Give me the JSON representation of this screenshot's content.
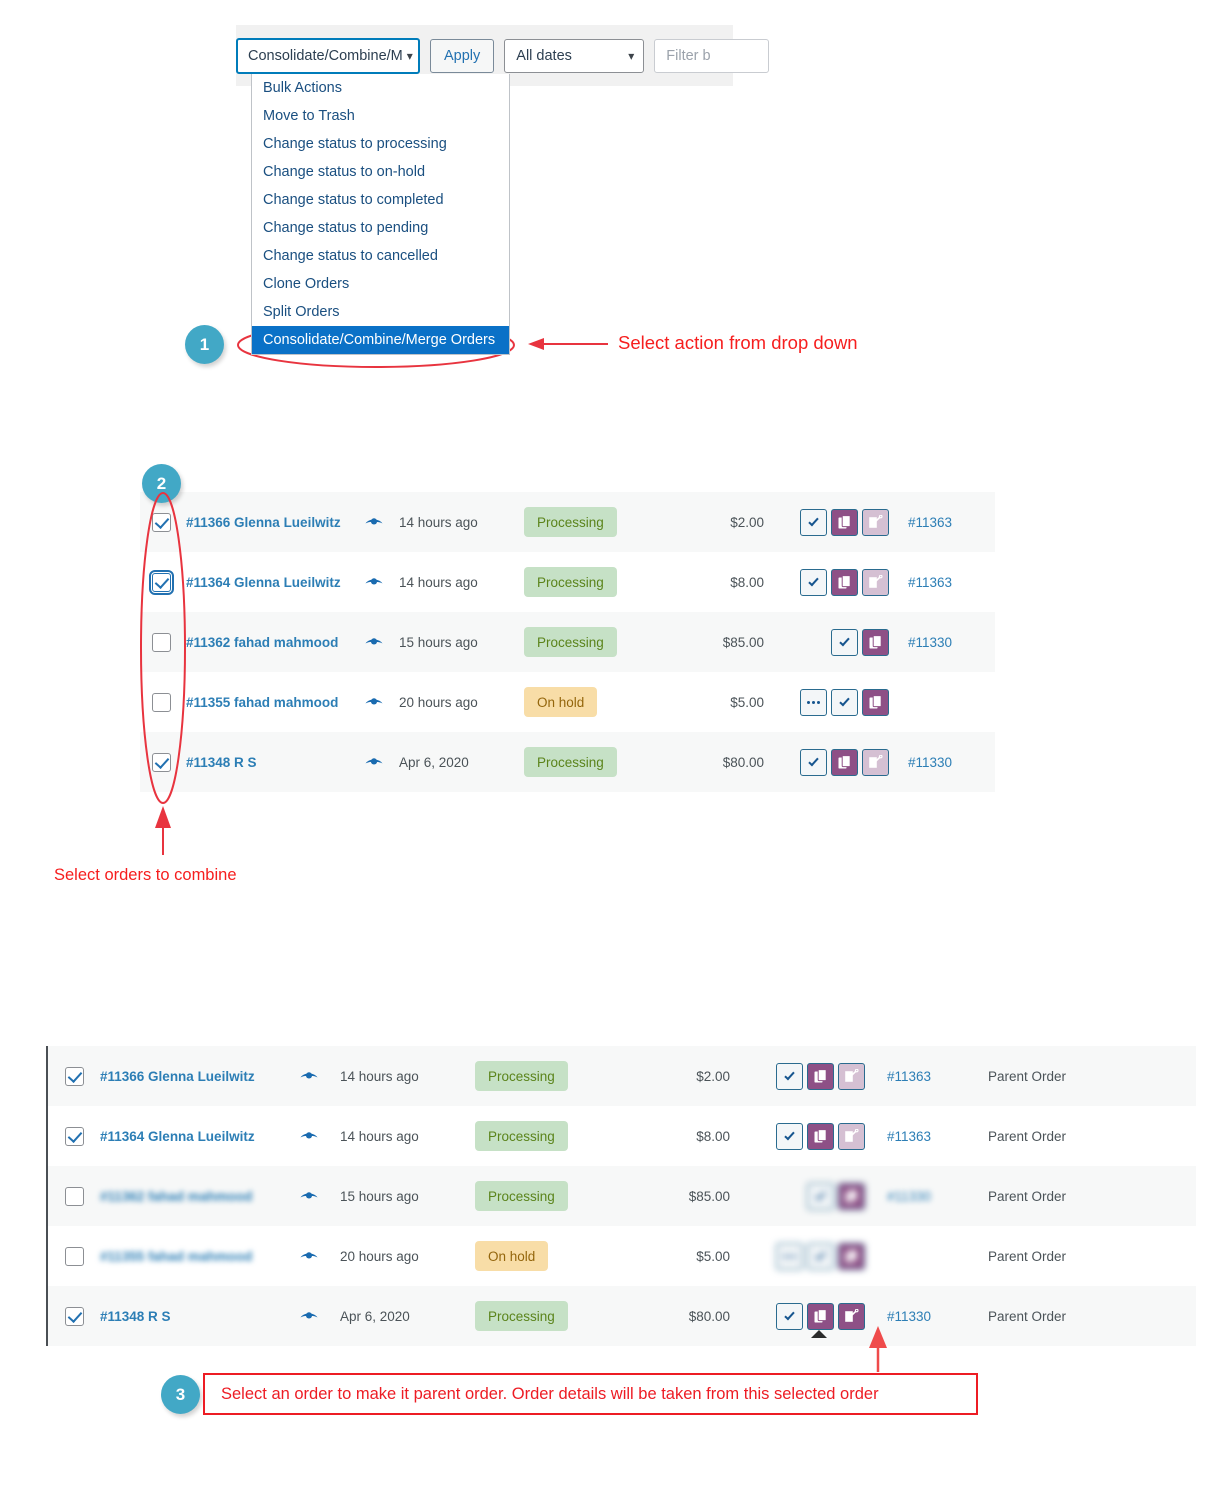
{
  "toolbar": {
    "bulk_action_value": "Consolidate/Combine/M",
    "apply_label": "Apply",
    "dates_value": "All dates",
    "filter_placeholder": "Filter b",
    "caret": "⌄"
  },
  "bulk_dropdown": {
    "items": [
      {
        "label": "Bulk Actions",
        "selected": false
      },
      {
        "label": "Move to Trash",
        "selected": false
      },
      {
        "label": "Change status to processing",
        "selected": false
      },
      {
        "label": "Change status to on-hold",
        "selected": false
      },
      {
        "label": "Change status to completed",
        "selected": false
      },
      {
        "label": "Change status to pending",
        "selected": false
      },
      {
        "label": "Change status to cancelled",
        "selected": false
      },
      {
        "label": "Clone Orders",
        "selected": false
      },
      {
        "label": "Split Orders",
        "selected": false
      },
      {
        "label": "Consolidate/Combine/Merge Orders",
        "selected": true
      }
    ]
  },
  "middle_table": {
    "rows": [
      {
        "checked": true,
        "focused": false,
        "order": "#11366 Glenna Lueilwitz",
        "date": "14 hours ago",
        "status": "Processing",
        "status_kind": "processing",
        "total": "$2.00",
        "parent": "#11363",
        "actions": [
          "check",
          "copy",
          "tag"
        ],
        "blurred": false
      },
      {
        "checked": true,
        "focused": true,
        "order": "#11364 Glenna Lueilwitz",
        "date": "14 hours ago",
        "status": "Processing",
        "status_kind": "processing",
        "total": "$8.00",
        "parent": "#11363",
        "actions": [
          "check",
          "copy",
          "tag"
        ],
        "blurred": false
      },
      {
        "checked": false,
        "focused": false,
        "order": "#11362 fahad mahmood",
        "date": "15 hours ago",
        "status": "Processing",
        "status_kind": "processing",
        "total": "$85.00",
        "parent": "#11330",
        "actions": [
          "check",
          "copy"
        ],
        "blurred": false
      },
      {
        "checked": false,
        "focused": false,
        "order": "#11355 fahad mahmood",
        "date": "20 hours ago",
        "status": "On hold",
        "status_kind": "onhold",
        "total": "$5.00",
        "parent": "",
        "actions": [
          "dots",
          "check",
          "copy"
        ],
        "blurred": false
      },
      {
        "checked": true,
        "focused": false,
        "order": "#11348 R S",
        "date": "Apr 6, 2020",
        "status": "Processing",
        "status_kind": "processing",
        "total": "$80.00",
        "parent": "#11330",
        "actions": [
          "check",
          "copy",
          "tag"
        ],
        "blurred": false
      }
    ]
  },
  "bottom_table": {
    "parent_order_label": "Parent Order",
    "rows": [
      {
        "checked": true,
        "order": "#11366 Glenna Lueilwitz",
        "date": "14 hours ago",
        "status": "Processing",
        "status_kind": "processing",
        "total": "$2.00",
        "parent": "#11363",
        "actions": [
          "check",
          "copy",
          "tag"
        ],
        "parent_text": "Parent Order",
        "blurred": false,
        "tag_selected": false
      },
      {
        "checked": true,
        "order": "#11364 Glenna Lueilwitz",
        "date": "14 hours ago",
        "status": "Processing",
        "status_kind": "processing",
        "total": "$8.00",
        "parent": "#11363",
        "actions": [
          "check",
          "copy",
          "tag"
        ],
        "parent_text": "Parent Order",
        "blurred": false,
        "tag_selected": false
      },
      {
        "checked": false,
        "order": "#11362 fahad mahmood",
        "date": "15 hours ago",
        "status": "Processing",
        "status_kind": "processing",
        "total": "$85.00",
        "parent": "#11330",
        "actions": [
          "check",
          "copy"
        ],
        "parent_text": "Parent Order",
        "blurred": true,
        "tag_selected": false
      },
      {
        "checked": false,
        "order": "#11355 fahad mahmood",
        "date": "20 hours ago",
        "status": "On hold",
        "status_kind": "onhold",
        "total": "$5.00",
        "parent": "",
        "actions": [
          "dots",
          "check",
          "copy"
        ],
        "parent_text": "Parent Order",
        "blurred": true,
        "tag_selected": false
      },
      {
        "checked": true,
        "order": "#11348 R S",
        "date": "Apr 6, 2020",
        "status": "Processing",
        "status_kind": "processing",
        "total": "$80.00",
        "parent": "#11330",
        "actions": [
          "check",
          "copy",
          "tag"
        ],
        "parent_text": "Parent Order",
        "blurred": false,
        "tag_selected": true
      }
    ]
  },
  "annotations": {
    "step1_badge": "1",
    "step1_text": "Select action from drop down",
    "step2_badge": "2",
    "step2_text": "Select orders to combine",
    "step3_badge": "3",
    "step3_text": "Select an order to make it parent order. Order details will be taken from this selected order"
  },
  "colors": {
    "accent_blue": "#0a71c7",
    "badge_teal": "#42a8c6",
    "annotation_red": "#ed1c24",
    "status_processing_bg": "#c6e1c6",
    "status_processing_fg": "#5b841b",
    "status_onhold_bg": "#f8dda7",
    "status_onhold_fg": "#94660c",
    "action_dark_purple": "#8e5086",
    "action_light_purple": "#d5c0d3",
    "link_blue": "#2c7eb5"
  }
}
